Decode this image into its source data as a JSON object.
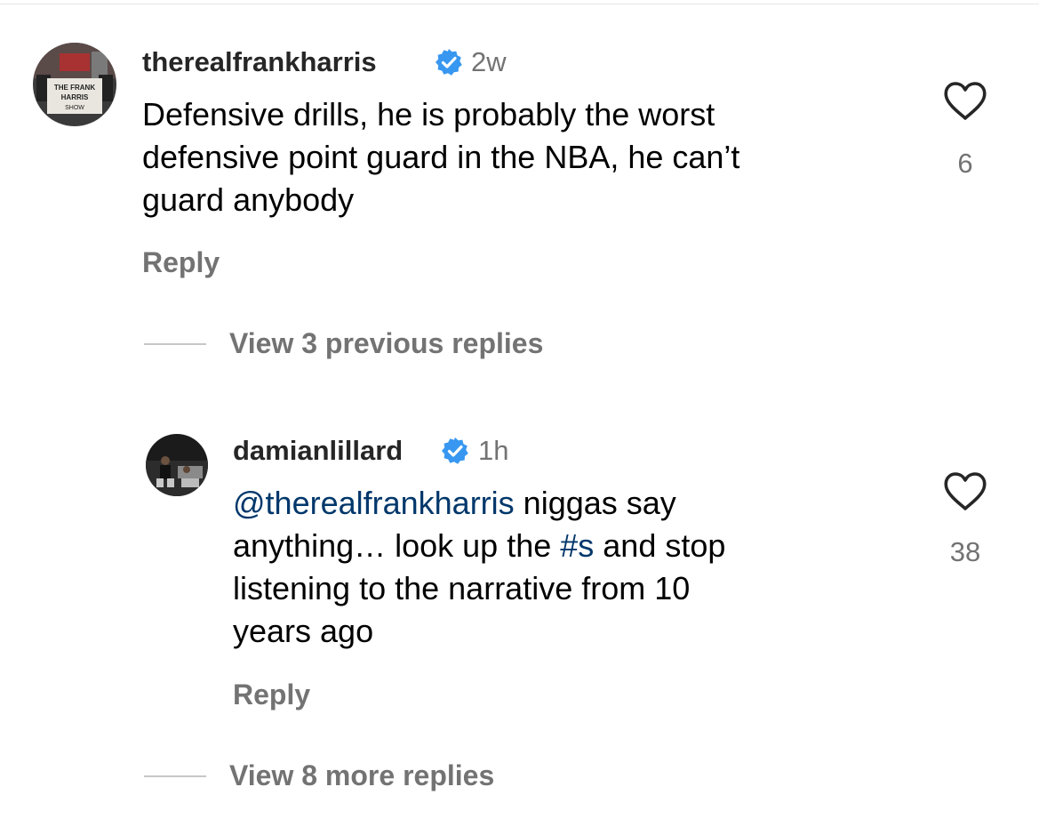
{
  "colors": {
    "verified": "#3897f0",
    "mention": "#00376b",
    "secondary": "#737373"
  },
  "comment1": {
    "avatar_lines": [
      "THE FRANK",
      "HARRIS",
      "SHOW"
    ],
    "username": "therealfrankharris",
    "time": "2w",
    "text_lines": [
      "Defensive drills, he is probably the worst",
      "defensive point guard in the NBA, he can’t",
      "guard anybody"
    ],
    "reply_label": "Reply",
    "like_count": "6"
  },
  "view_previous": "View 3 previous replies",
  "reply1": {
    "username": "damianlillard",
    "time": "1h",
    "mention": "@therealfrankharris",
    "line1_rest": " niggas say",
    "line2_before": "anything… look up the ",
    "hashtag": "#s",
    "line2_after": " and stop",
    "line3": "listening to the narrative from 10",
    "line4": "years ago",
    "reply_label": "Reply",
    "like_count": "38"
  },
  "view_more": "View 8 more replies",
  "icons": {
    "verified": "verified-badge-icon",
    "like": "heart-outline-icon"
  }
}
